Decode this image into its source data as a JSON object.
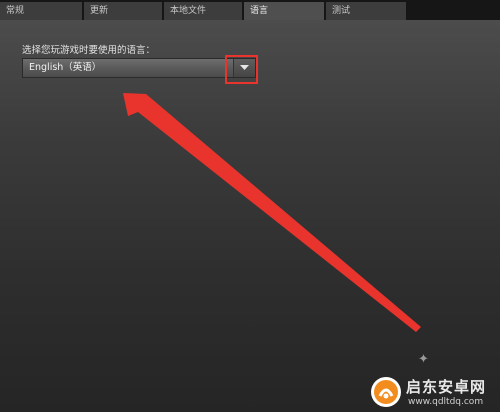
{
  "tabs": [
    {
      "label": "常规",
      "active": false
    },
    {
      "label": "更新",
      "active": false
    },
    {
      "label": "本地文件",
      "active": false
    },
    {
      "label": "语言",
      "active": true
    },
    {
      "label": "测试",
      "active": false
    }
  ],
  "language": {
    "prompt": "选择您玩游戏时要使用的语言：",
    "selected": "English（英语）"
  },
  "watermark": {
    "title": "启东安卓网",
    "url": "www.qdltdq.com"
  },
  "colors": {
    "annotation_red": "#e8342c",
    "tab_active_bg": "#4f4f4f",
    "tab_bg": "#3d3d3d"
  },
  "icons": {
    "dropdown": "chevron-down-icon",
    "annotation": "arrow-icon"
  }
}
